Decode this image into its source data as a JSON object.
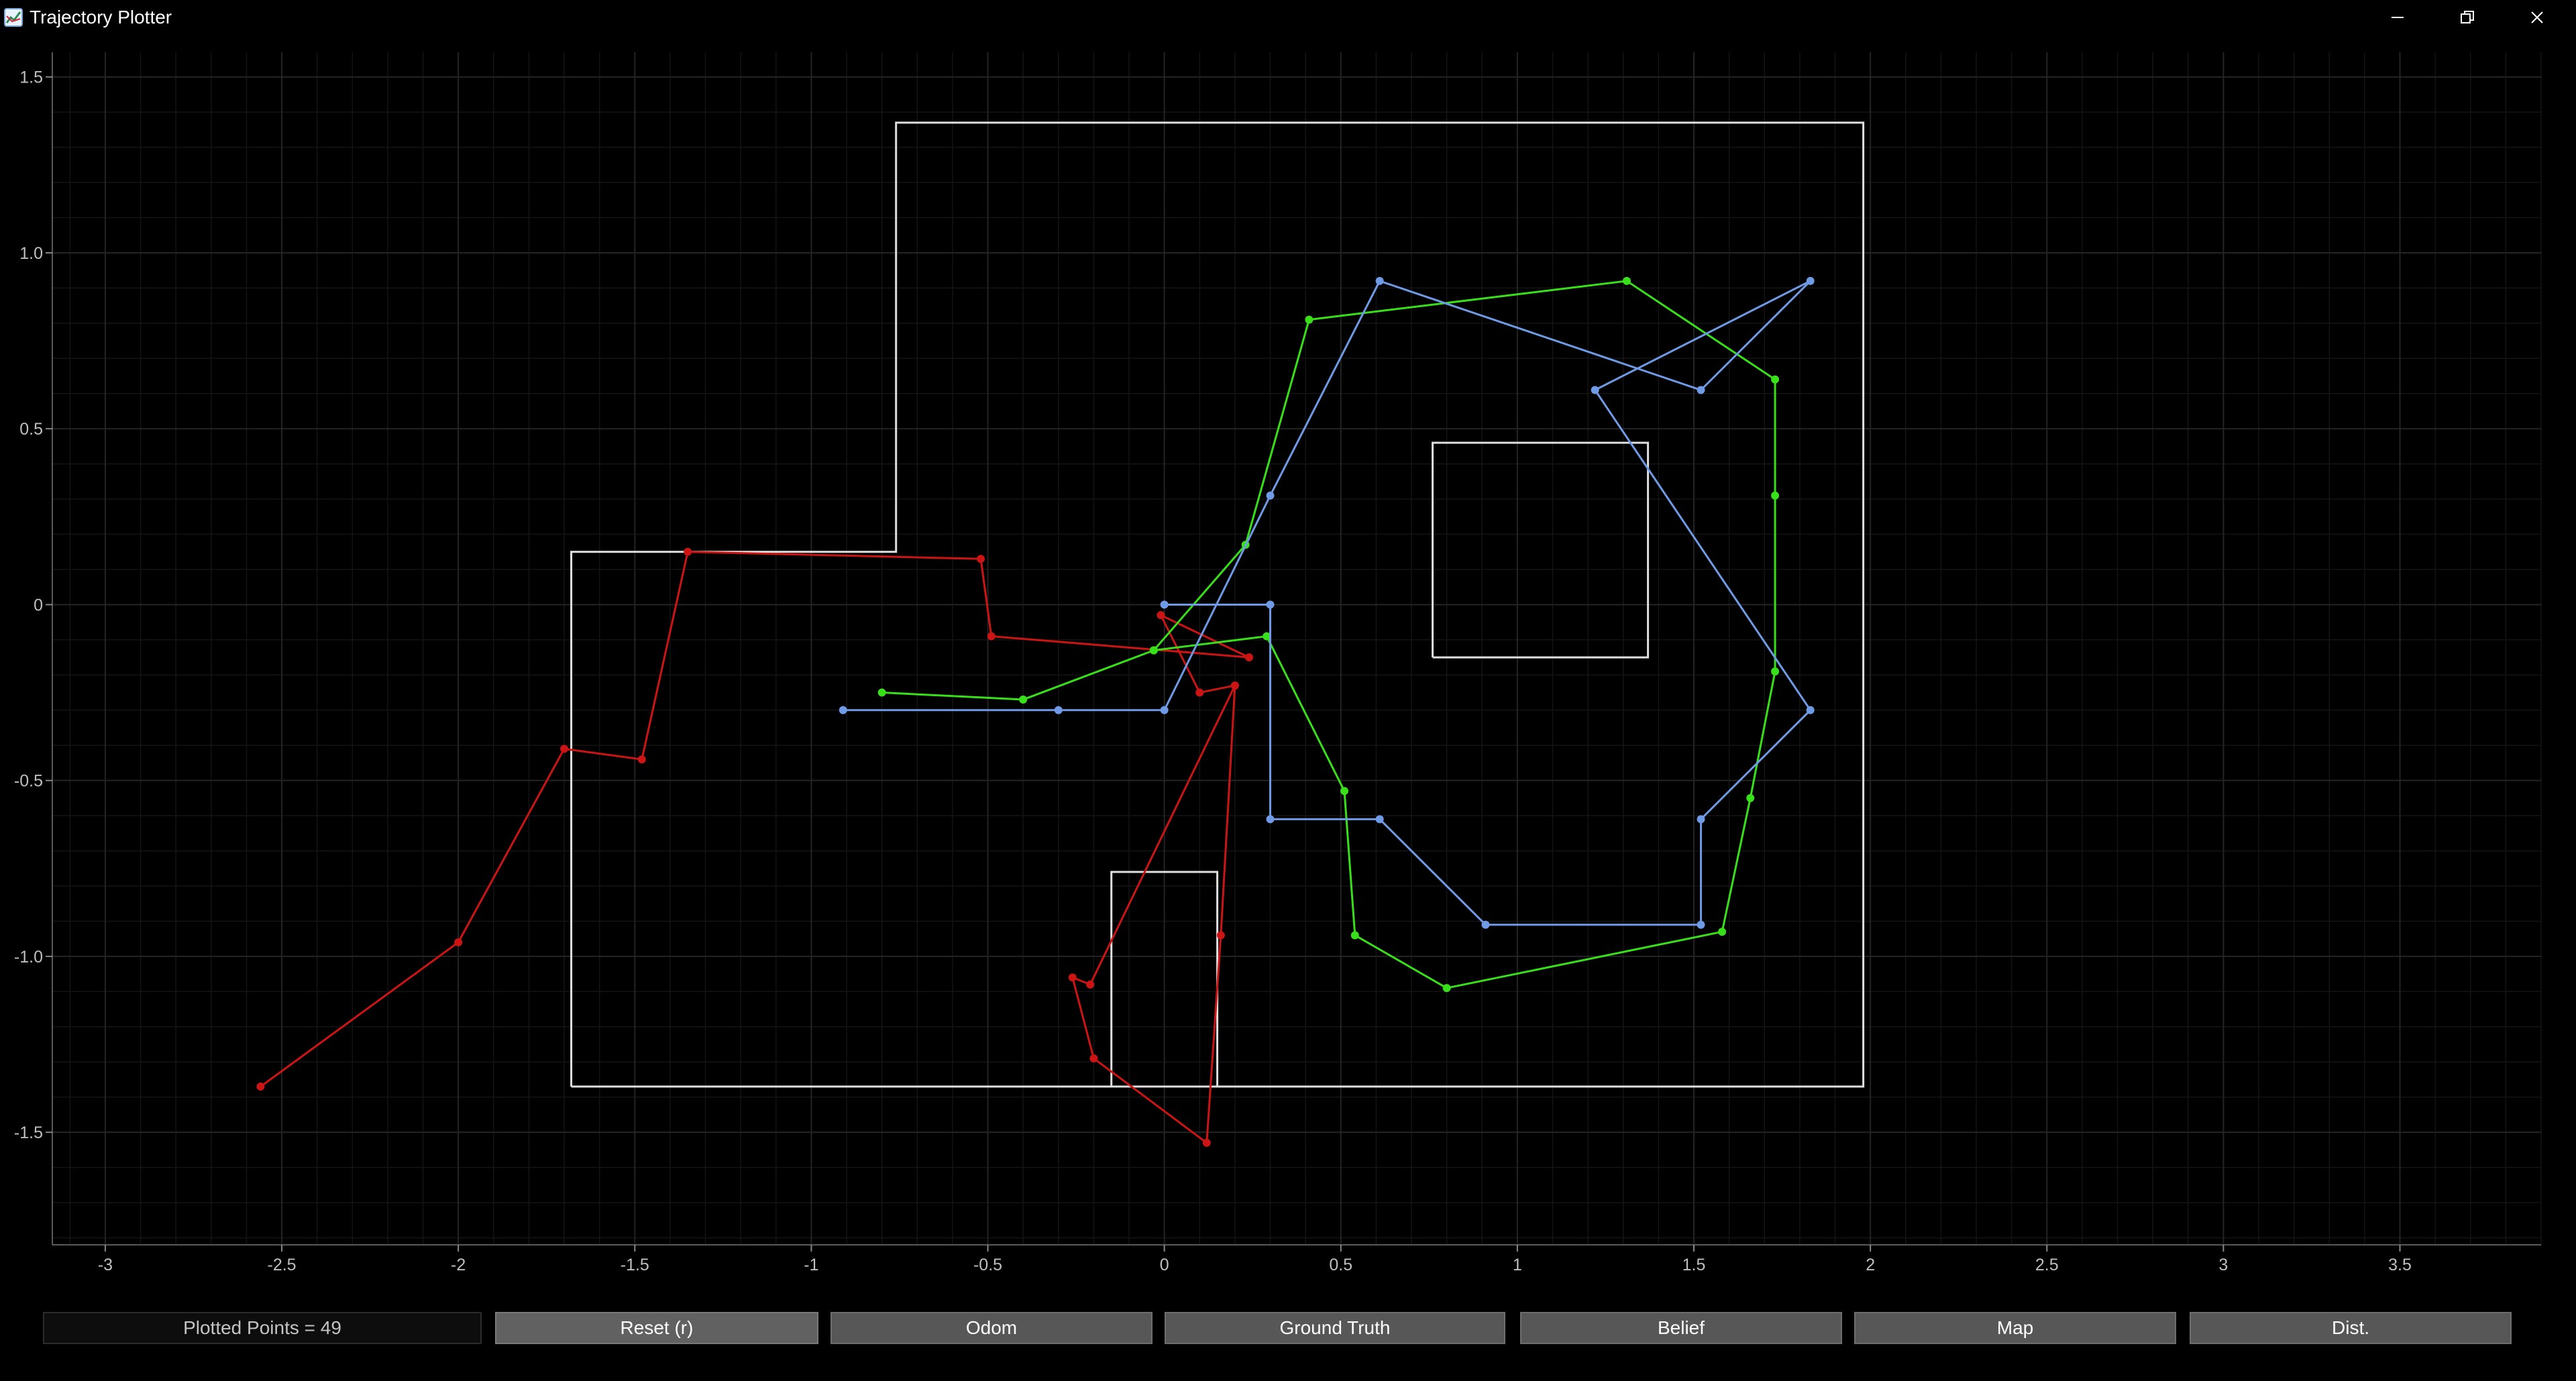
{
  "window": {
    "title": "Trajectory Plotter"
  },
  "status": {
    "plotted_points": "Plotted Points = 49"
  },
  "buttons": [
    {
      "label": "Reset (r)",
      "active": true
    },
    {
      "label": "Odom",
      "active": false
    },
    {
      "label": "Ground Truth",
      "active": false
    },
    {
      "label": "Belief",
      "active": false
    },
    {
      "label": "Map",
      "active": false
    },
    {
      "label": "Dist.",
      "active": false
    }
  ],
  "colors": {
    "odom": "#cc1414",
    "ground_truth": "#38e01a",
    "belief": "#6f9ae6",
    "map": "#e0e0e0",
    "grid": "#242424",
    "grid_minor": "#141414"
  },
  "chart_data": {
    "type": "line",
    "xlim": [
      -3.15,
      3.9
    ],
    "ylim": [
      -1.82,
      1.57
    ],
    "x_ticks": [
      -3,
      -2.5,
      -2,
      -1.5,
      -1,
      -0.5,
      0,
      0.5,
      1,
      1.5,
      2,
      2.5,
      3,
      3.5
    ],
    "x_tick_labels": [
      "-3",
      "-2.5",
      "-2",
      "-1.5",
      "-1",
      "-0.5",
      "0",
      "0.5",
      "1",
      "1.5",
      "2",
      "2.5",
      "3",
      "3.5"
    ],
    "y_ticks": [
      1.5,
      1.0,
      0.5,
      0,
      -0.5,
      -1.0,
      -1.5
    ],
    "y_tick_labels": [
      "1.5",
      "1.0",
      "0.5",
      "0",
      "-0.5",
      "-1.0",
      "-1.5"
    ],
    "grid": true,
    "series": [
      {
        "key": "odom",
        "points": [
          [
            -2.56,
            -1.37
          ],
          [
            -2.0,
            -0.96
          ],
          [
            -1.7,
            -0.41
          ],
          [
            -1.48,
            -0.44
          ],
          [
            -1.35,
            0.15
          ],
          [
            -0.52,
            0.13
          ],
          [
            -0.49,
            -0.09
          ],
          [
            0.24,
            -0.15
          ],
          [
            -0.01,
            -0.03
          ],
          [
            0.1,
            -0.25
          ],
          [
            0.2,
            -0.23
          ],
          [
            -0.21,
            -1.08
          ],
          [
            -0.26,
            -1.06
          ],
          [
            -0.2,
            -1.29
          ],
          [
            0.12,
            -1.53
          ],
          [
            0.16,
            -0.94
          ],
          [
            0.2,
            -0.23
          ]
        ]
      },
      {
        "key": "ground_truth",
        "points": [
          [
            -0.8,
            -0.25
          ],
          [
            -0.4,
            -0.27
          ],
          [
            -0.03,
            -0.13
          ],
          [
            0.23,
            0.17
          ],
          [
            0.41,
            0.81
          ],
          [
            1.31,
            0.92
          ],
          [
            1.73,
            0.64
          ],
          [
            1.73,
            0.31
          ],
          [
            1.73,
            -0.19
          ],
          [
            1.66,
            -0.55
          ],
          [
            1.58,
            -0.93
          ],
          [
            0.8,
            -1.09
          ],
          [
            0.54,
            -0.94
          ],
          [
            0.51,
            -0.53
          ],
          [
            0.29,
            -0.09
          ],
          [
            -0.03,
            -0.13
          ]
        ]
      },
      {
        "key": "belief",
        "points": [
          [
            -0.91,
            -0.3
          ],
          [
            -0.3,
            -0.3
          ],
          [
            0.0,
            -0.3
          ],
          [
            0.3,
            0.31
          ],
          [
            0.61,
            0.92
          ],
          [
            1.52,
            0.61
          ],
          [
            1.83,
            0.92
          ],
          [
            1.22,
            0.61
          ],
          [
            1.83,
            -0.3
          ],
          [
            1.52,
            -0.61
          ],
          [
            1.52,
            -0.91
          ],
          [
            0.91,
            -0.91
          ],
          [
            0.61,
            -0.61
          ],
          [
            0.3,
            -0.61
          ],
          [
            0.3,
            0.0
          ],
          [
            0.0,
            0.0
          ]
        ]
      }
    ],
    "map_polylines": [
      [
        [
          -1.68,
          -1.37
        ],
        [
          1.98,
          -1.37
        ],
        [
          1.98,
          1.37
        ],
        [
          -0.76,
          1.37
        ],
        [
          -0.76,
          0.15
        ],
        [
          -1.68,
          0.15
        ],
        [
          -1.68,
          -1.37
        ]
      ],
      [
        [
          0.76,
          -0.15
        ],
        [
          1.37,
          -0.15
        ],
        [
          1.37,
          0.46
        ],
        [
          0.76,
          0.46
        ],
        [
          0.76,
          -0.15
        ]
      ],
      [
        [
          -0.15,
          -1.37
        ],
        [
          -0.15,
          -0.76
        ],
        [
          0.15,
          -0.76
        ],
        [
          0.15,
          -1.37
        ]
      ]
    ]
  }
}
